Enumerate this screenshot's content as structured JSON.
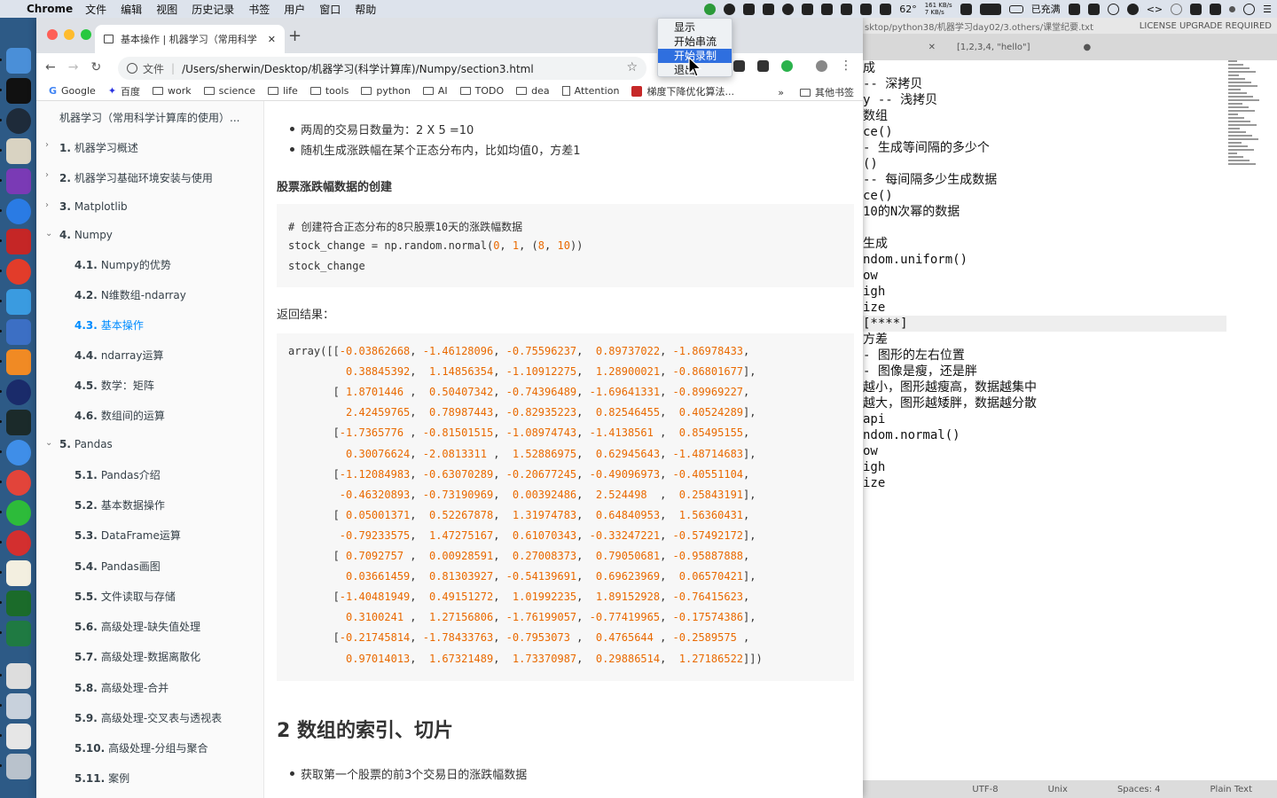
{
  "menubar": {
    "app": "Chrome",
    "items": [
      "文件",
      "编辑",
      "视图",
      "历史记录",
      "书签",
      "用户",
      "窗口",
      "帮助"
    ],
    "battery": "62°",
    "net_up": "161 KB/s",
    "net_down": "7 KB/s",
    "charging": "已充满"
  },
  "tray_menu": {
    "items": [
      "显示",
      "开始串流",
      "开始录制",
      "退出"
    ],
    "selected_index": 2
  },
  "chrome": {
    "tab_title": "基本操作 | 机器学习（常用科学",
    "url_scheme": "文件",
    "url": "/Users/sherwin/Desktop/机器学习(科学计算库)/Numpy/section3.html",
    "bookmarks": [
      "Google",
      "百度",
      "work",
      "science",
      "life",
      "tools",
      "python",
      "AI",
      "TODO",
      "dea",
      "Attention",
      "梯度下降优化算法..."
    ],
    "bookmarks_more": "»",
    "other_bookmarks": "其他书签"
  },
  "toc": {
    "title": "机器学习（常用科学计算库的使用）...",
    "items": [
      {
        "num": "1.",
        "label": "机器学习概述",
        "level": 1,
        "arrow": "›"
      },
      {
        "num": "2.",
        "label": "机器学习基础环境安装与使用",
        "level": 1,
        "arrow": "›"
      },
      {
        "num": "3.",
        "label": "Matplotlib",
        "level": 1,
        "arrow": "›"
      },
      {
        "num": "4.",
        "label": "Numpy",
        "level": 1,
        "arrow": "⌄"
      },
      {
        "num": "4.1.",
        "label": "Numpy的优势",
        "level": 2
      },
      {
        "num": "4.2.",
        "label": "N维数组-ndarray",
        "level": 2
      },
      {
        "num": "4.3.",
        "label": "基本操作",
        "level": 2,
        "active": true
      },
      {
        "num": "4.4.",
        "label": "ndarray运算",
        "level": 2
      },
      {
        "num": "4.5.",
        "label": "数学：矩阵",
        "level": 2
      },
      {
        "num": "4.6.",
        "label": "数组间的运算",
        "level": 2
      },
      {
        "num": "5.",
        "label": "Pandas",
        "level": 1,
        "arrow": "⌄"
      },
      {
        "num": "5.1.",
        "label": "Pandas介绍",
        "level": 2
      },
      {
        "num": "5.2.",
        "label": "基本数据操作",
        "level": 2
      },
      {
        "num": "5.3.",
        "label": "DataFrame运算",
        "level": 2
      },
      {
        "num": "5.4.",
        "label": "Pandas画图",
        "level": 2
      },
      {
        "num": "5.5.",
        "label": "文件读取与存储",
        "level": 2
      },
      {
        "num": "5.6.",
        "label": "高级处理-缺失值处理",
        "level": 2
      },
      {
        "num": "5.7.",
        "label": "高级处理-数据离散化",
        "level": 2
      },
      {
        "num": "5.8.",
        "label": "高级处理-合并",
        "level": 2
      },
      {
        "num": "5.9.",
        "label": "高级处理-交叉表与透视表",
        "level": 2
      },
      {
        "num": "5.10.",
        "label": "高级处理-分组与聚合",
        "level": 2
      },
      {
        "num": "5.11.",
        "label": "案例",
        "level": 2
      }
    ]
  },
  "article": {
    "bullets_top": [
      "两周的交易日数量为：2 X 5 =10",
      "随机生成涨跌幅在某个正态分布内，比如均值0，方差1"
    ],
    "subhead": "股票涨跌幅数据的创建",
    "code_comment": "# 创建符合正态分布的8只股票10天的涨跌幅数据",
    "code_line1_pre": "stock_change = np.random.normal(",
    "code_line1_args": [
      "0",
      "1",
      "8",
      "10"
    ],
    "code_line2": "stock_change",
    "result_label": "返回结果：",
    "array_prefix": "array([[",
    "array_rows": [
      [
        "-0.03862668",
        "-1.46128096",
        "-0.75596237",
        "0.89737022",
        "-1.86978433"
      ],
      [
        "0.38845392",
        "1.14856354",
        "-1.10912275",
        "1.28900021",
        "-0.86801677"
      ],
      [
        "1.8701446 ",
        "0.50407342",
        "-0.74396489",
        "-1.69641331",
        "-0.89969227"
      ],
      [
        "2.42459765",
        "0.78987443",
        "-0.82935223",
        "0.82546455",
        "0.40524289"
      ],
      [
        "-1.7365776 ",
        "-0.81501515",
        "-1.08974743",
        "-1.4138561 ",
        "0.85495155"
      ],
      [
        "0.30076624",
        "-2.0813311 ",
        "1.52886975",
        "0.62945643",
        "-1.48714683"
      ],
      [
        "-1.12084983",
        "-0.63070289",
        "-0.20677245",
        "-0.49096973",
        "-0.40551104"
      ],
      [
        "-0.46320893",
        "-0.73190969",
        "0.00392486",
        "2.524498  ",
        "0.25843191"
      ],
      [
        "0.05001371",
        "0.52267878",
        "1.31974783",
        "0.64840953",
        "1.56360431"
      ],
      [
        "-0.79233575",
        "1.47275167",
        "0.61070343",
        "-0.33247221",
        "-0.57492172"
      ],
      [
        "0.7092757 ",
        "0.00928591",
        "0.27008373",
        "0.79050681",
        "-0.95887888"
      ],
      [
        "0.03661459",
        "0.81303927",
        "-0.54139691",
        "0.69623969",
        "0.06570421"
      ],
      [
        "-1.40481949",
        "0.49151272",
        "1.01992235",
        "1.89152928",
        "-0.76415623"
      ],
      [
        "0.3100241 ",
        "1.27156806",
        "-1.76199057",
        "-0.77419965",
        "-0.17574386"
      ],
      [
        "-0.21745814",
        "-1.78433763",
        "-0.7953073 ",
        "0.4765644 ",
        "-0.2589575 "
      ],
      [
        "0.97014013",
        "1.67321489",
        "1.73370987",
        "0.29886514",
        "1.27186522"
      ]
    ],
    "section_title": "2 数组的索引、切片",
    "bullet_bottom": "获取第一个股票的前3个交易日的涨跌幅数据"
  },
  "sublime": {
    "path": "sktop/python38/机器学习day02/3.others/课堂纪要.txt",
    "license": "LICENSE UPGRADE REQUIRED",
    "tab2": "[1,2,3,4, \"hello\"]",
    "lines": [
      "成",
      "-- 深拷贝",
      "y -- 浅拷贝",
      "数组",
      "ce()",
      "- 生成等间隔的多少个",
      "()",
      "-- 每间隔多少生成数据",
      "ce()",
      "10的N次幂的数据",
      "",
      "生成",
      "ndom.uniform()",
      "ow",
      "igh",
      "ize",
      "[****]",
      "方差",
      "- 图形的左右位置",
      "- 图像是瘦，还是胖",
      "越小，图形越瘦高，数据越集中",
      "越大，图形越矮胖，数据越分散",
      "api",
      "ndom.normal()",
      "ow",
      "igh",
      "ize"
    ],
    "status": [
      "UTF-8",
      "Unix",
      "Spaces: 4",
      "Plain Text"
    ]
  }
}
